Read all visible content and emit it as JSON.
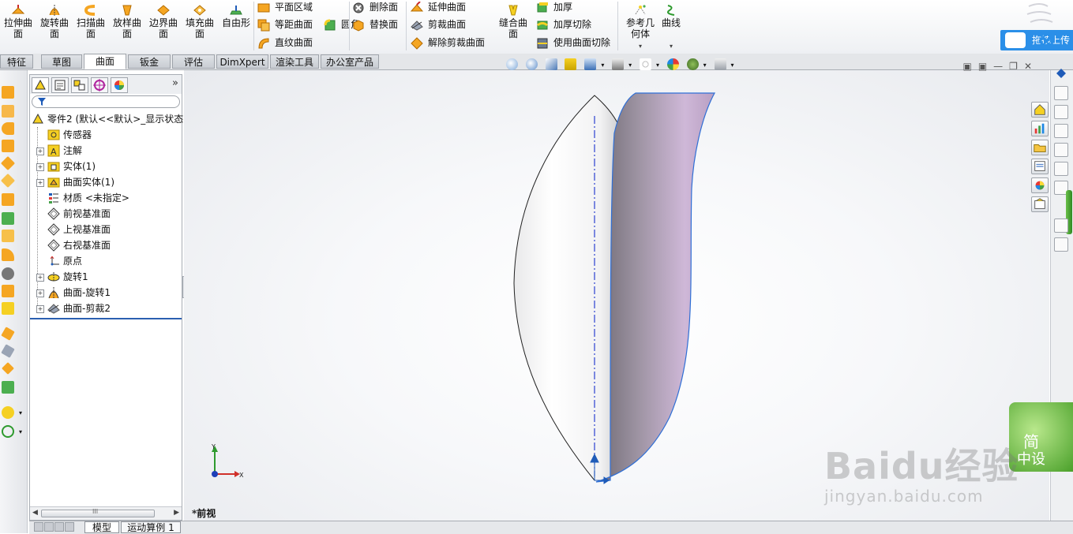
{
  "ribbon": {
    "big_buttons": [
      {
        "label": "拉伸曲\n面"
      },
      {
        "label": "旋转曲\n面"
      },
      {
        "label": "扫描曲\n面"
      },
      {
        "label": "放样曲\n面"
      },
      {
        "label": "边界曲\n面"
      },
      {
        "label": "填充曲\n面"
      },
      {
        "label": "自由形"
      }
    ],
    "group1": [
      "平面区域",
      "等距曲面",
      "直纹曲面"
    ],
    "fillet": "圆角",
    "group2": [
      "删除面",
      "替换面"
    ],
    "group3": [
      "延伸曲面",
      "剪裁曲面",
      "解除剪裁曲面"
    ],
    "knit": "缝合曲\n面",
    "group4": [
      "加厚",
      "加厚切除",
      "使用曲面切除"
    ],
    "ref_geometry": "参考几\n何体",
    "curves": "曲线",
    "upload_label": "拖拽上传"
  },
  "tabs": [
    "特征",
    "草图",
    "曲面",
    "钣金",
    "评估",
    "DimXpert",
    "渲染工具",
    "办公室产品"
  ],
  "active_tab": "曲面",
  "feature_tree": {
    "root": "零件2 (默认<<默认>_显示状态",
    "items": [
      {
        "label": "传感器",
        "expandable": false
      },
      {
        "label": "注解",
        "expandable": true
      },
      {
        "label": "实体(1)",
        "expandable": true
      },
      {
        "label": "曲面实体(1)",
        "expandable": true
      },
      {
        "label": "材质 <未指定>",
        "expandable": false
      },
      {
        "label": "前视基准面",
        "expandable": false
      },
      {
        "label": "上视基准面",
        "expandable": false
      },
      {
        "label": "右视基准面",
        "expandable": false
      },
      {
        "label": "原点",
        "expandable": false
      },
      {
        "label": "旋转1",
        "expandable": true
      },
      {
        "label": "曲面-旋转1",
        "expandable": true
      },
      {
        "label": "曲面-剪裁2",
        "expandable": true
      }
    ],
    "expand_glyph": "»",
    "scroll_mid": "III"
  },
  "bottom_tabs": [
    "模型",
    "运动算例 1"
  ],
  "viewport": {
    "view_label": "*前视",
    "axis_x": "X",
    "axis_y": "Y"
  },
  "overlays": {
    "badge_line1": "简",
    "badge_line2": "中设",
    "watermark_main": "Baidu经验",
    "watermark_sub": "jingyan.baidu.com"
  },
  "colors": {
    "surface_purple": "#b79fc1",
    "highlight_blue": "#2b8fe8",
    "tree_selection": "#2a5fb0"
  }
}
